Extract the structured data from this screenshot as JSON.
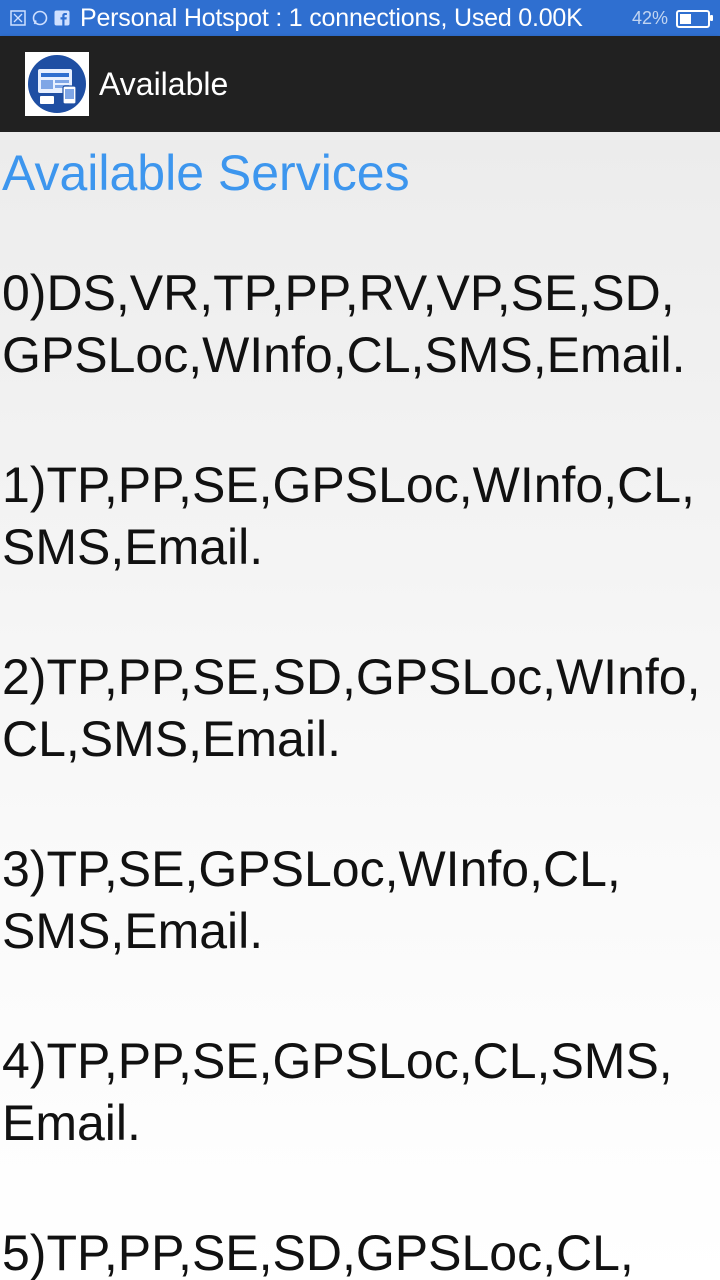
{
  "status_bar": {
    "notification_text": "Personal Hotspot : 1 connections, Used 0.00K",
    "battery_pct": "42%",
    "battery_level": 0.42,
    "icons": [
      "sim-icon",
      "whatsapp-icon",
      "facebook-icon",
      "battery-icon"
    ]
  },
  "app_bar": {
    "title": "Available",
    "logo_icon": "app-logo-icon"
  },
  "main": {
    "section_title": "Available Services",
    "services": [
      "0)DS,VR,TP,PP,RV,VP,SE,SD, GPSLoc,WInfo,CL,SMS,Email.",
      "1)TP,PP,SE,GPSLoc,WInfo,CL, SMS,Email.",
      "2)TP,PP,SE,SD,GPSLoc,WInfo, CL,SMS,Email.",
      "3)TP,SE,GPSLoc,WInfo,CL, SMS,Email.",
      "4)TP,PP,SE,GPSLoc,CL,SMS, Email.",
      "5)TP,PP,SE,SD,GPSLoc,CL,"
    ]
  },
  "colors": {
    "status_bar": "#2f6fd0",
    "app_bar": "#212121",
    "accent": "#3d96ee"
  }
}
